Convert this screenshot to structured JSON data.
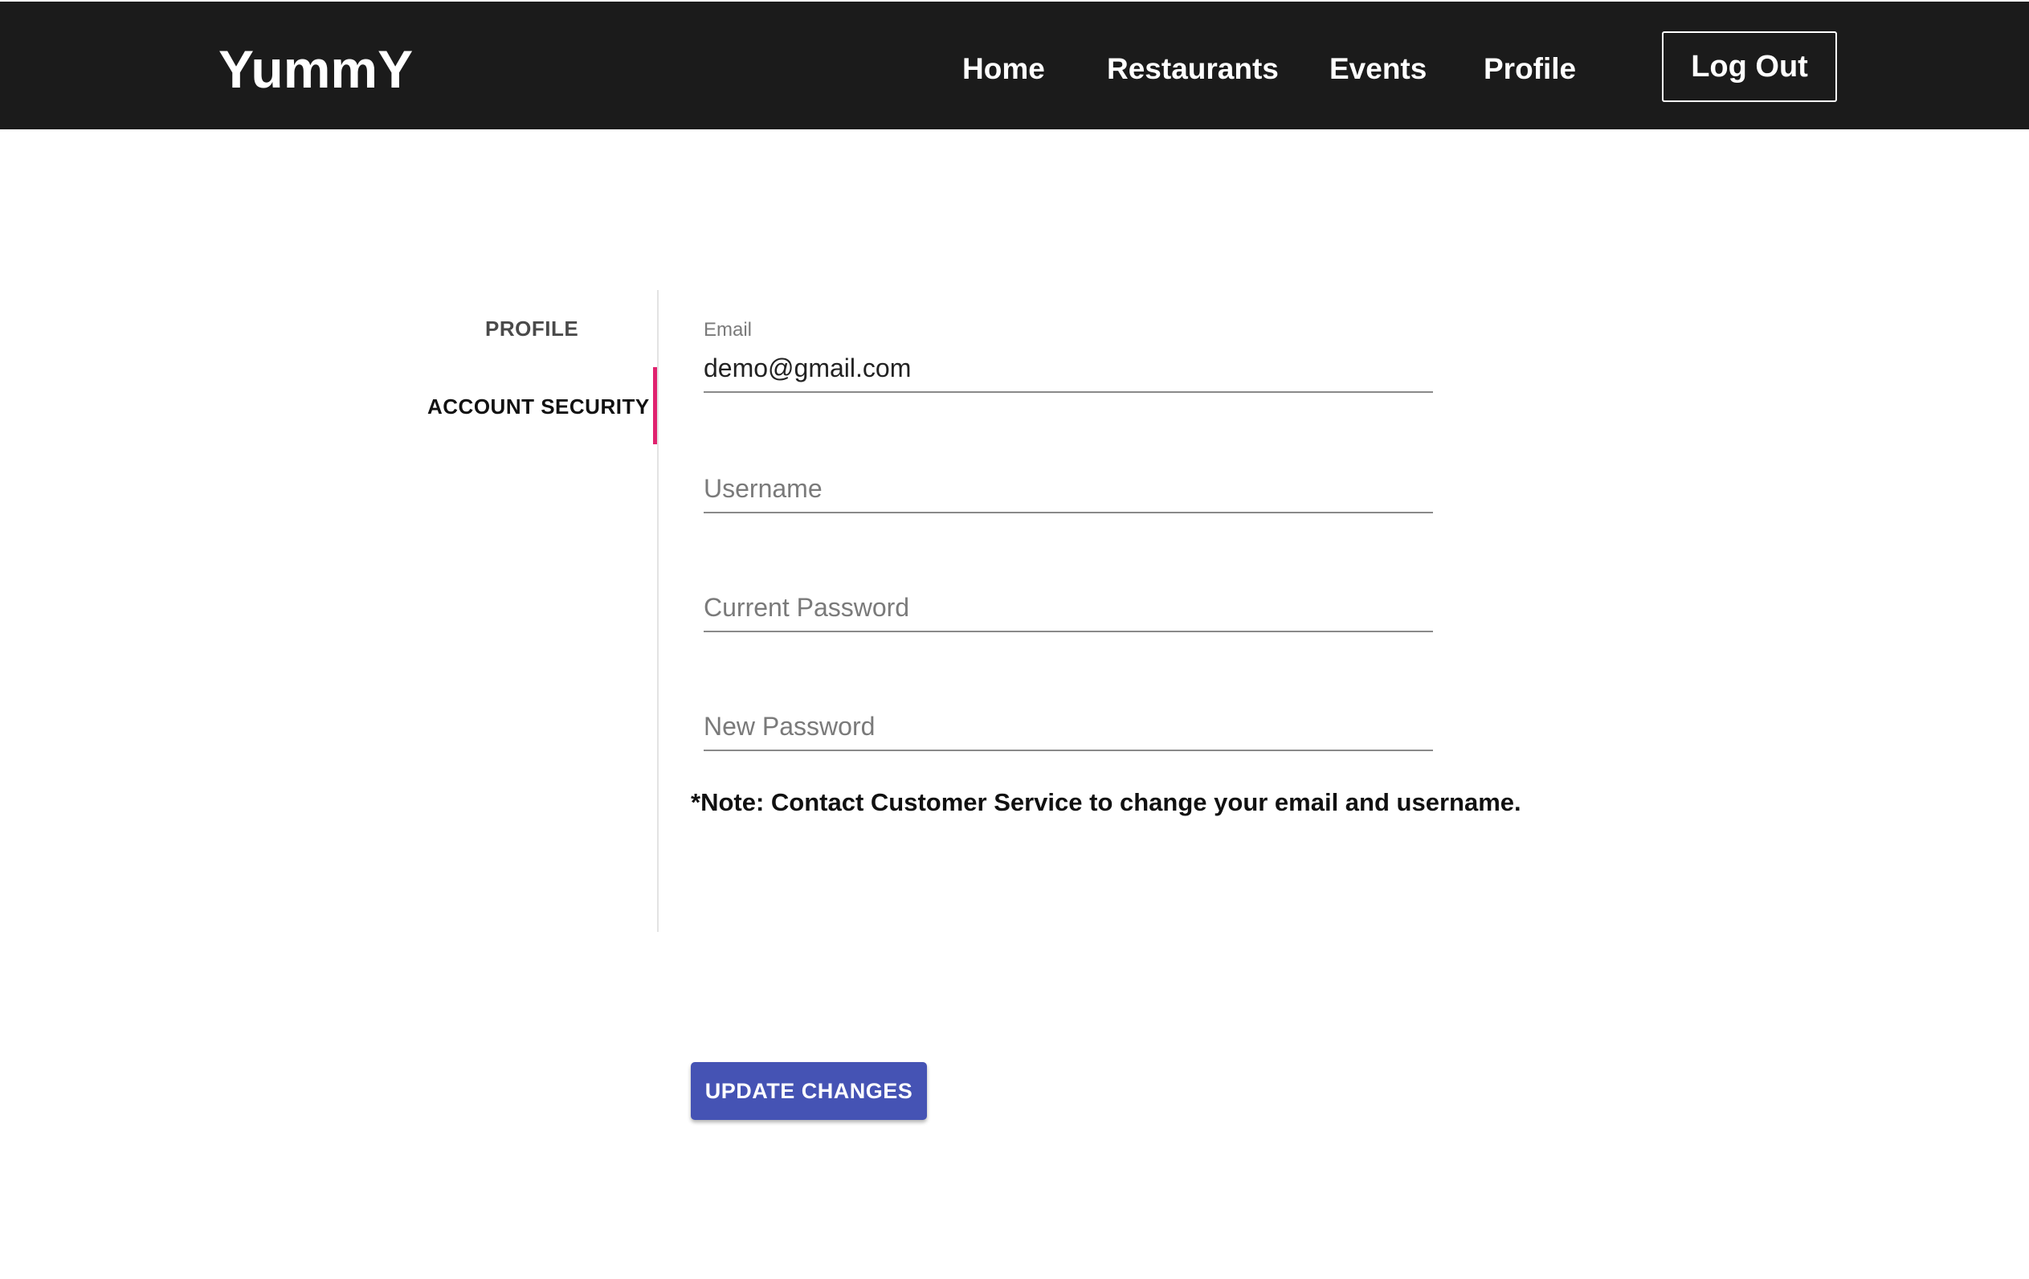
{
  "header": {
    "brand": "YummY",
    "nav": [
      {
        "label": "Home"
      },
      {
        "label": "Restaurants"
      },
      {
        "label": "Events"
      },
      {
        "label": "Profile"
      }
    ],
    "logout_label": "Log Out",
    "background_color": "#1b1b1b"
  },
  "sidebar": {
    "tabs": [
      {
        "label": "PROFILE",
        "active": false
      },
      {
        "label": "ACCOUNT SECURITY",
        "active": true
      }
    ],
    "active_indicator_color": "#e0226e"
  },
  "form": {
    "email": {
      "label": "Email",
      "value": "demo@gmail.com"
    },
    "username": {
      "placeholder": "Username",
      "value": ""
    },
    "current_password": {
      "placeholder": "Current Password",
      "value": ""
    },
    "new_password": {
      "placeholder": "New Password",
      "value": ""
    },
    "note": "*Note: Contact Customer Service to change your email and username.",
    "submit_label": "UPDATE CHANGES",
    "submit_color": "#4553b4"
  }
}
